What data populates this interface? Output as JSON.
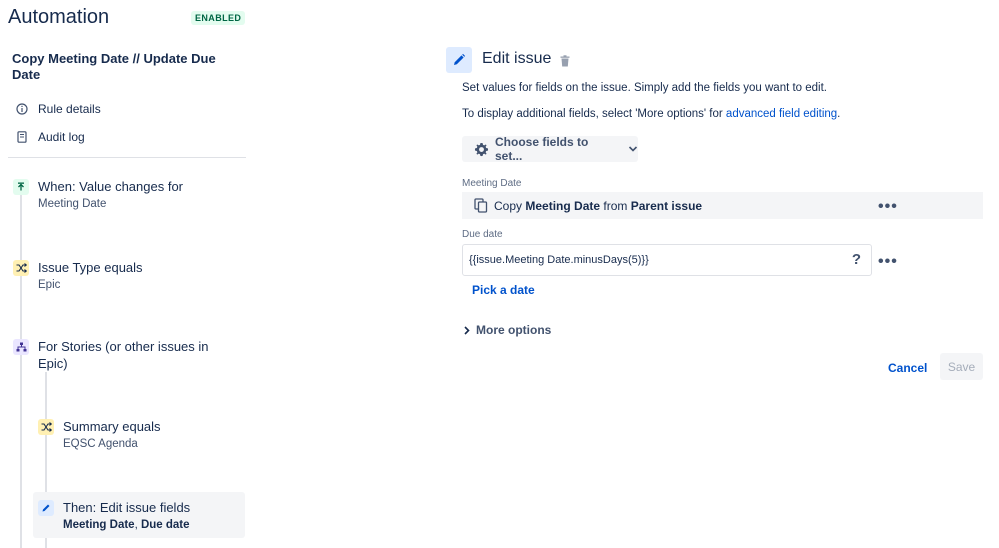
{
  "header": {
    "title": "Automation",
    "status_badge": "ENABLED"
  },
  "rule": {
    "name": "Copy Meeting Date // Update Due Date"
  },
  "sidebar_links": [
    {
      "label": "Rule details",
      "icon": "info-icon"
    },
    {
      "label": "Audit log",
      "icon": "document-icon"
    }
  ],
  "steps": {
    "trigger": {
      "title": "When: Value changes for",
      "sub": "Meeting Date",
      "icon": "trigger-icon"
    },
    "condition1": {
      "title": "Issue Type equals",
      "sub": "Epic",
      "icon": "condition-shuffle-icon"
    },
    "branch": {
      "title": "For Stories (or other issues in Epic)",
      "icon": "branch-icon"
    },
    "condition2": {
      "title": "Summary equals",
      "sub": "EQSC Agenda",
      "icon": "condition-shuffle-icon"
    },
    "action": {
      "title": "Then: Edit issue fields",
      "sub_part1": "Meeting Date",
      "sub_sep": ", ",
      "sub_part2": "Due date",
      "icon": "pencil-icon"
    }
  },
  "panel": {
    "title": "Edit issue",
    "desc1": "Set values for fields on the issue. Simply add the fields you want to edit.",
    "desc2_prefix": "To display additional fields, select 'More options' for ",
    "desc2_link": "advanced field editing",
    "desc2_suffix": ".",
    "choose_fields_label": "Choose fields to set...",
    "meeting_date": {
      "label": "Meeting Date",
      "copy_word": "Copy",
      "field": "Meeting Date",
      "from_word": "from",
      "source": "Parent issue"
    },
    "due_date": {
      "label": "Due date",
      "value": "{{issue.Meeting Date.minusDays(5)}}",
      "help": "?",
      "pick_label": "Pick a date"
    },
    "more_options": "More options",
    "cancel": "Cancel",
    "save": "Save"
  },
  "colors": {
    "accent": "#0052cc",
    "badge_green_bg": "#e3fcef",
    "badge_green_text": "#006644",
    "condition_yellow": "#fff0b3",
    "branch_purple": "#eae6ff"
  }
}
